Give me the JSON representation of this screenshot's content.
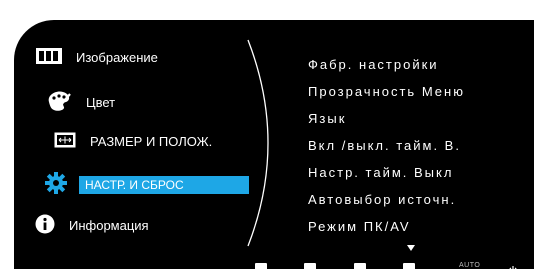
{
  "left_menu": {
    "items": [
      {
        "label": "Изображение",
        "icon": "picture-icon"
      },
      {
        "label": "Цвет",
        "icon": "palette-icon"
      },
      {
        "label": "РАЗМЕР И ПОЛОЖ.",
        "icon": "position-icon"
      },
      {
        "label": "НАСТР. И СБРОС",
        "icon": "gear-icon",
        "selected": true
      },
      {
        "label": "Информация",
        "icon": "info-icon"
      }
    ]
  },
  "right_menu": {
    "items": [
      "Фабр. настройки",
      "Прозрачность Меню",
      "Язык",
      "Вкл /выкл. тайм. В.",
      "Настр. тайм. Выкл",
      "Автовыбор источн.",
      "Режим ПК/AV"
    ]
  },
  "bottom_bar": {
    "auto_label": "AUTO"
  },
  "colors": {
    "background": "#000000",
    "text": "#ffffff",
    "accent_selection": "#1ea7e6"
  }
}
